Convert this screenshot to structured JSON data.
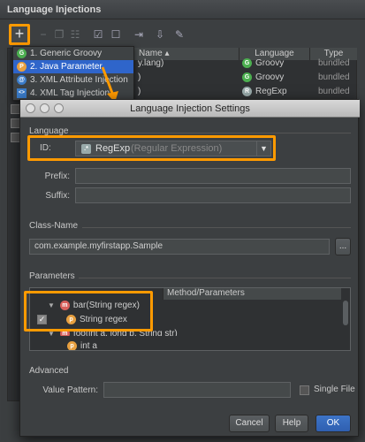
{
  "outer": {
    "title": "Language Injections",
    "add_icon": "+",
    "remove_icon": "−",
    "columns": {
      "name": "Name ▴",
      "language": "Language",
      "type": "Type"
    },
    "rows": [
      {
        "name": "y.lang)",
        "language": "Groovy",
        "type": "bundled"
      },
      {
        "name": ")",
        "language": "Groovy",
        "type": "bundled"
      },
      {
        "name": ")",
        "language": "RegExp",
        "type": "bundled"
      }
    ]
  },
  "popup": {
    "items": [
      {
        "label": "1. Generic Groovy",
        "icon": "G"
      },
      {
        "label": "2. Java Parameter",
        "icon": "P"
      },
      {
        "label": "3. XML Attribute Injection",
        "icon": "@"
      },
      {
        "label": "4. XML Tag Injection",
        "icon": "<>"
      }
    ]
  },
  "dialog": {
    "title": "Language Injection Settings",
    "language_section": "Language",
    "id_label": "ID:",
    "id_value": "RegExp",
    "id_hint": "(Regular Expression)",
    "prefix_label": "Prefix:",
    "suffix_label": "Suffix:",
    "class_section": "Class-Name",
    "class_value": "com.example.myfirstapp.Sample",
    "browse_label": "...",
    "params_section": "Parameters",
    "params_header": "Method/Parameters",
    "tree": [
      {
        "label": "bar(String regex)",
        "icon": "m"
      },
      {
        "label": "String regex",
        "icon": "p"
      },
      {
        "label": "foo(int a, long b, String str)",
        "icon": "m"
      },
      {
        "label": "int a",
        "icon": "p"
      }
    ],
    "advanced_section": "Advanced",
    "value_pattern_label": "Value Pattern:",
    "single_file_label": "Single File",
    "cancel_label": "Cancel",
    "help_label": "Help",
    "ok_label": "OK"
  },
  "colors": {
    "highlight": "#ff9a00",
    "selection": "#2f65ca",
    "primary_button": "#2f5fb0"
  }
}
